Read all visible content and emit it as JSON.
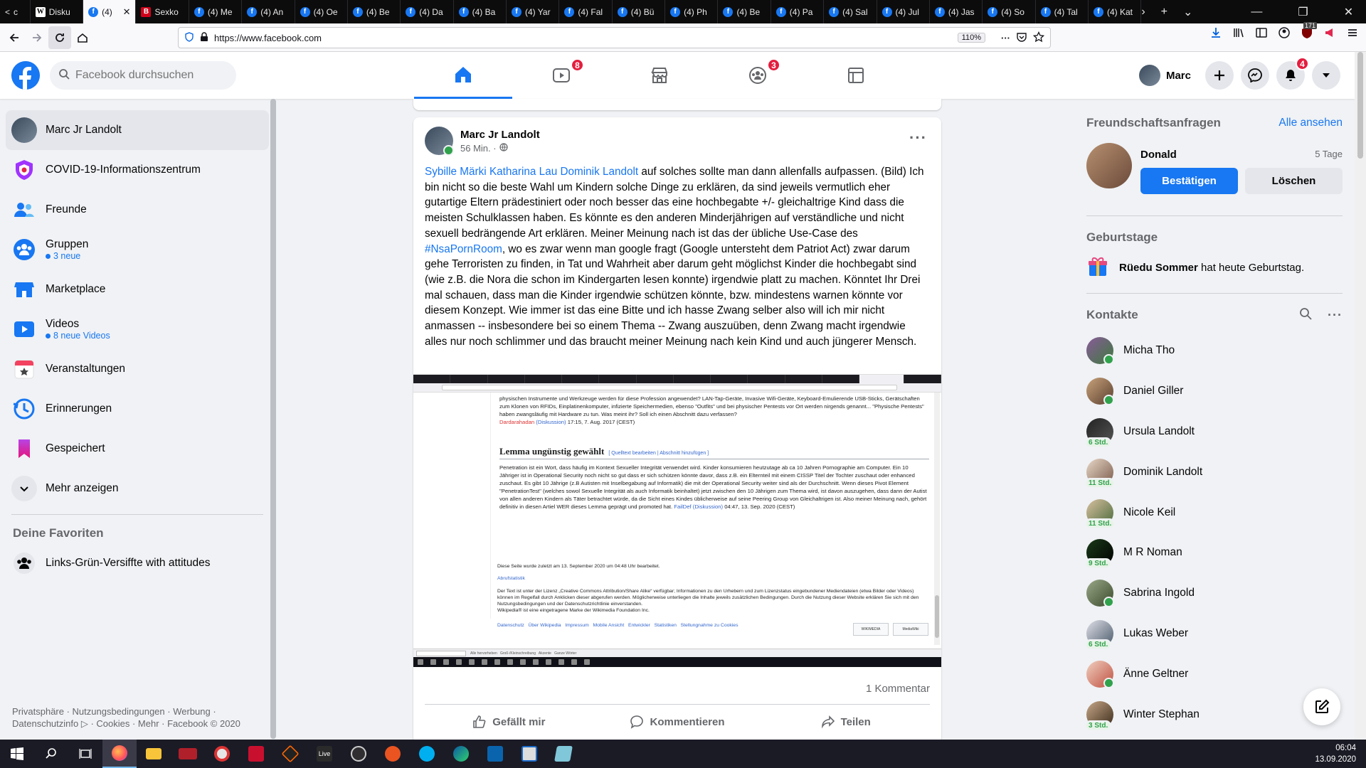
{
  "browser": {
    "tabs": [
      {
        "label": "c",
        "icon": "arrow-icon"
      },
      {
        "label": "Disku",
        "icon": "wikipedia"
      },
      {
        "label": "(4)",
        "icon": "facebook",
        "active": true
      },
      {
        "label": "Sexko",
        "icon": "red-b"
      },
      {
        "label": "(4) Me",
        "icon": "facebook"
      },
      {
        "label": "(4) An",
        "icon": "facebook"
      },
      {
        "label": "(4) Oe",
        "icon": "facebook"
      },
      {
        "label": "(4) Be",
        "icon": "facebook"
      },
      {
        "label": "(4) Da",
        "icon": "facebook"
      },
      {
        "label": "(4) Ba",
        "icon": "facebook"
      },
      {
        "label": "(4) Yar",
        "icon": "facebook"
      },
      {
        "label": "(4) Fal",
        "icon": "facebook"
      },
      {
        "label": "(4) Bü",
        "icon": "facebook"
      },
      {
        "label": "(4) Ph",
        "icon": "facebook"
      },
      {
        "label": "(4) Be",
        "icon": "facebook"
      },
      {
        "label": "(4) Pa",
        "icon": "facebook"
      },
      {
        "label": "(4) Sal",
        "icon": "facebook"
      },
      {
        "label": "(4) Jul",
        "icon": "facebook"
      },
      {
        "label": "(4) Jas",
        "icon": "facebook"
      },
      {
        "label": "(4) So",
        "icon": "facebook"
      },
      {
        "label": "(4) Tal",
        "icon": "facebook"
      },
      {
        "label": "(4) Kat",
        "icon": "facebook"
      }
    ],
    "url": "https://www.facebook.com",
    "zoom": "110%",
    "ext_badge": "171"
  },
  "header": {
    "search_placeholder": "Facebook durchsuchen",
    "watch_badge": "8",
    "groups_badge": "3",
    "notif_badge": "4",
    "profile_name": "Marc"
  },
  "left": {
    "profile": "Marc Jr Landolt",
    "items": [
      {
        "label": "COVID-19-Informationszentrum"
      },
      {
        "label": "Freunde"
      },
      {
        "label": "Gruppen",
        "sub": "3 neue"
      },
      {
        "label": "Marketplace"
      },
      {
        "label": "Videos",
        "sub": "8 neue Videos"
      },
      {
        "label": "Veranstaltungen"
      },
      {
        "label": "Erinnerungen"
      },
      {
        "label": "Gespeichert"
      },
      {
        "label": "Mehr anzeigen"
      }
    ],
    "favorites_title": "Deine Favoriten",
    "favorite_group": "Links-Grün-Versiffte with attitudes",
    "footer_line1": "Privatsphäre · Nutzungsbedingungen · Werbung ·",
    "footer_line2": "Datenschutzinfo ▷ · Cookies · Mehr · Facebook © 2020"
  },
  "post": {
    "author": "Marc Jr Landolt",
    "time": "56 Min. ·",
    "mentions": [
      "Sybille Märki",
      "Katharina Lau",
      "Dominik Landolt"
    ],
    "text_part1": " auf solches sollte man dann allenfalls aufpassen. (Bild) Ich bin nicht so die beste Wahl um Kindern solche Dinge zu erklären, da sind jeweils vermutlich eher gutartige Eltern prädestiniert oder noch besser das eine hochbegabte +/- gleichaltrige Kind dass die meisten Schulklassen haben. Es könnte es den anderen Minderjährigen auf verständliche und nicht sexuell bedrängende Art erklären. Meiner Meinung nach ist das der übliche Use-Case des ",
    "hashtag": "#NsaPornRoom",
    "text_part2": ", wo es zwar wenn man google fragt (Google untersteht dem Patriot Act) zwar darum gehe Terroristen zu finden, in Tat und Wahrheit aber darum geht möglichst Kinder die hochbegabt sind (wie z.B. die Nora die schon im Kindergarten lesen konnte) irgendwie platt zu machen. Könntet Ihr Drei mal schauen, dass man die Kinder irgendwie schützen könnte, bzw. mindestens warnen könnte vor diesem Konzept. Wie immer ist das eine Bitte und ich hasse Zwang selber also will ich mir nicht anmassen -- insbesondere bei so einem Thema -- Zwang auszuüben, denn Zwang macht irgendwie alles nur noch schlimmer und das braucht meiner Meinung nach kein Kind und auch jüngerer Mensch.",
    "image": {
      "top_text": "physischen Instrumente und Werkzeuge werden für diese Profession angewendet? LAN-Tap-Geräte, Invasive Wifi-Geräte, Keyboard-Emulierende USB-Sticks, Gerätschaften zum Klonen von RFIDs, Einplatinenkomputer, infizierte Speichermedien, ebenso \"Outfits\" und bei physischer Pentests vor Ort werden nirgends genannt... \"Physische Pentests\" haben zwangsläufig mit Hardware zu tun. Was meint ihr? Soll ich einen Abschnitt dazu verfassen?",
      "sig1_user": "Dardarahadan",
      "sig1_talk": "(Diskussion)",
      "sig1_date": " 17:15, 7. Aug. 2017 (CEST)",
      "heading": "Lemma ungünstig gewählt",
      "heading_links": "[ Quelltext bearbeiten | Abschnitt hinzufügen ]",
      "body": "Penetration ist ein Wort, dass häufig im Kontext Sexueller Integrität verwendet wird. Kinder konsumieren heutzutage ab ca 10 Jahren Pornographie am Computer. Ein 10 Jähriger ist in Operational Security noch nicht so gut dass er sich schützen könnte davor, dass z.B. ein Elternteil mit einem CISSP Titel der Tochter zuschaut oder enhanced zuschaut. Es gibt 10 Jährige (z.B Autisten mit Inselbegabung auf Informatik) die mit der Operational Security weiter sind als der Durchschnitt. Wenn dieses Pivot Element \"PenetrationTest\" (welches sowol Sexuelle Integrität als auch Informatik beinhaltet) jetzt zwischen den 10 Jährigen zum Thema wird, ist davon auszugehen, dass dann der Autist von allen anderen Kindern als Täter betrachtet würde, da die Sicht eines Kindes üblicherweise auf seine Peering Group von Gleichaltrigen ist. Also meiner Meinung nach, gehört definitiv in diesen Artiel WER dieses Lemma geprägt und promoted hat.",
      "sig2_user": "FailDef",
      "sig2_talk": "(Diskussion)",
      "sig2_date": " 04:47, 13. Sep. 2020 (CEST)",
      "foot1": "Diese Seite wurde zuletzt am 13. September 2020 um 04:48 Uhr bearbeitet.",
      "foot2": "Abrufstatistik",
      "foot3": "Der Text ist unter der Lizenz „Creative Commons Attribution/Share Alike“ verfügbar; Informationen zu den Urhebern und zum Lizenzstatus eingebundener Mediendateien (etwa Bilder oder Videos) können im Regelfall durch Anklicken dieser abgerufen werden. Möglicherweise unterliegen die Inhalte jeweils zusätzlichen Bedingungen. Durch die Nutzung dieser Website erklären Sie sich mit den Nutzungsbedingungen und der Datenschutzrichtlinie einverstanden.",
      "foot4": "Wikipedia® ist eine eingetragene Marke der Wikimedia Foundation Inc.",
      "foot_links": "Datenschutz   Über Wikipedia   Impressum   Mobile Ansicht   Entwickler   Statistiken   Stellungnahme zu Cookies",
      "logo1": "WIKIMEDIA",
      "logo2": "MediaWiki",
      "status_text": "Alle hervorheben   Groß-/Kleinschreibung   Akzente   Ganze Wörter"
    },
    "comments": "1 Kommentar",
    "like": "Gefällt mir",
    "comment": "Kommentieren",
    "share": "Teilen"
  },
  "right": {
    "requests_title": "Freundschaftsanfragen",
    "see_all": "Alle ansehen",
    "request": {
      "name": "Donald",
      "age": "5 Tage",
      "confirm": "Bestätigen",
      "delete": "Löschen"
    },
    "birthdays_title": "Geburtstage",
    "birthday_name": "Rüedu Sommer",
    "birthday_text": " hat heute Geburtstag.",
    "contacts_title": "Kontakte",
    "contacts": [
      {
        "name": "Micha Tho",
        "status": "online"
      },
      {
        "name": "Daniel Giller",
        "status": "online"
      },
      {
        "name": "Ursula Landolt",
        "status": "6 Std."
      },
      {
        "name": "Dominik Landolt",
        "status": "11 Std."
      },
      {
        "name": "Nicole Keil",
        "status": "11 Std."
      },
      {
        "name": "M R Noman",
        "status": "9 Std."
      },
      {
        "name": "Sabrina Ingold",
        "status": "online"
      },
      {
        "name": "Lukas Weber",
        "status": "6 Std."
      },
      {
        "name": "Änne Geltner",
        "status": "online"
      },
      {
        "name": "Winter Stephan",
        "status": "3 Std."
      }
    ]
  },
  "taskbar": {
    "time": "06:04",
    "date": "13.09.2020"
  }
}
